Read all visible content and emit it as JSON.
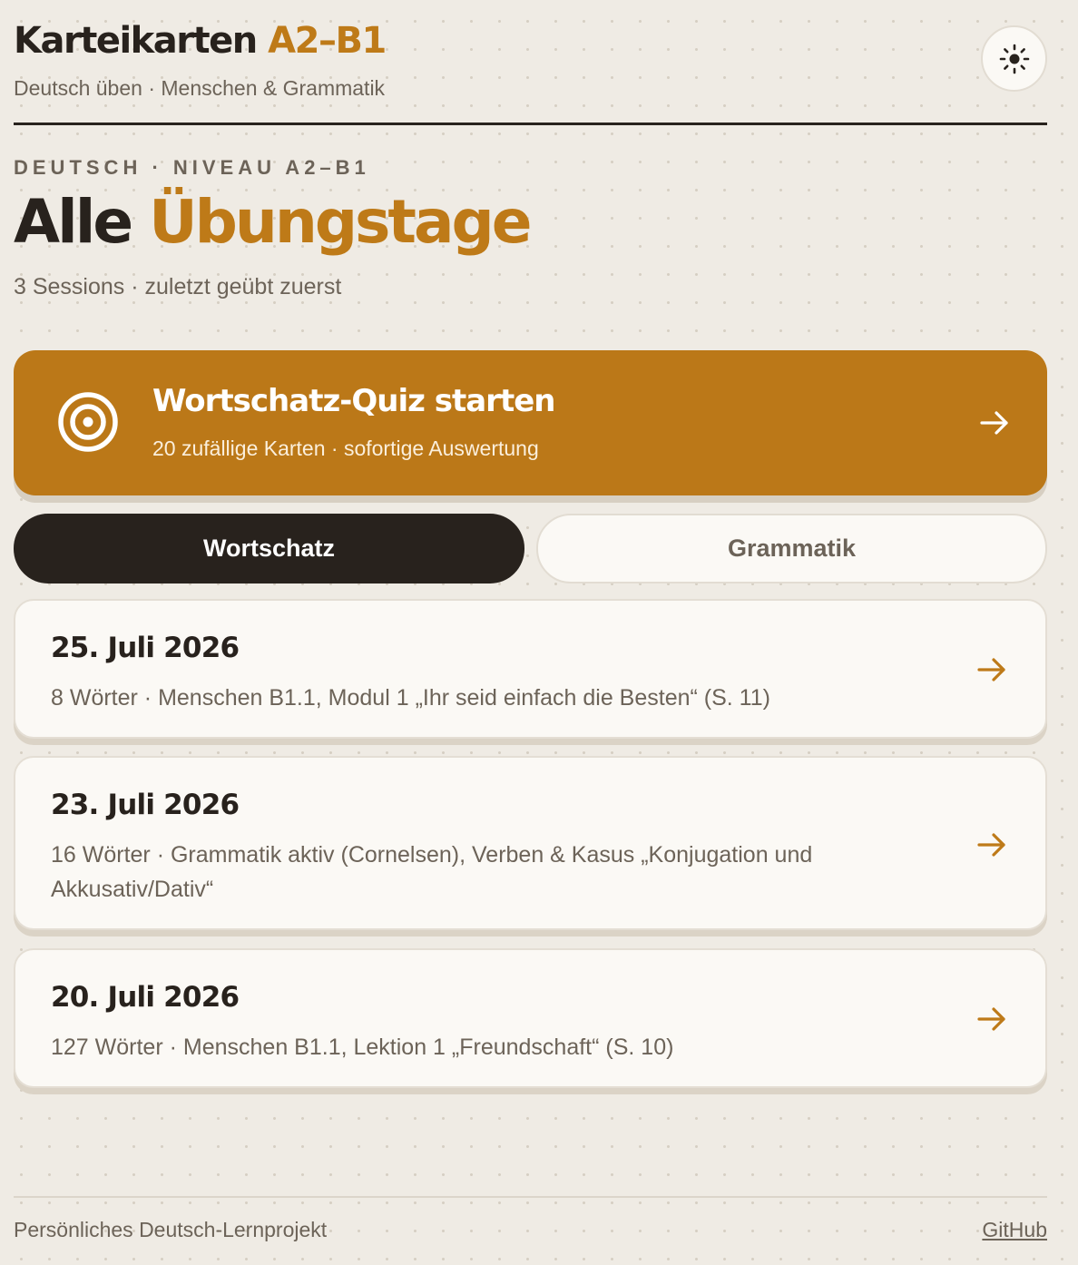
{
  "header": {
    "title": "Karteikarten",
    "title_accent": "A2–B1",
    "subtitle": "Deutsch üben · Menschen & Grammatik",
    "theme_icon": "sun-icon"
  },
  "hero": {
    "eyebrow": "DEUTSCH · NIVEAU A2–B1",
    "title": "Alle",
    "title_accent": "Übungstage",
    "meta": "3 Sessions · zuletzt geübt zuerst"
  },
  "quiz": {
    "icon": "target-icon",
    "title": "Wortschatz-Quiz starten",
    "subtitle": "20 zufällige Karten · sofortige Auswertung",
    "arrow_icon": "arrow-right-icon"
  },
  "tabs": [
    {
      "label": "Wortschatz",
      "active": true
    },
    {
      "label": "Grammatik",
      "active": false
    }
  ],
  "sessions": [
    {
      "date": "25. Juli 2026",
      "description": "8 Wörter · Menschen B1.1, Modul 1 „Ihr seid einfach die Besten“ (S. 11)"
    },
    {
      "date": "23. Juli 2026",
      "description": "16 Wörter · Grammatik aktiv (Cornelsen), Verben & Kasus „Konjugation und Akkusativ/Dativ“"
    },
    {
      "date": "20. Juli 2026",
      "description": "127 Wörter · Menschen B1.1, Lektion 1 „Freundschaft“ (S. 10)"
    }
  ],
  "footer": {
    "text": "Persönliches Deutsch-Lernprojekt",
    "link": "GitHub"
  },
  "colors": {
    "background": "#efebe4",
    "accent": "#be7a18",
    "ink": "#28221d",
    "muted": "#6c6358",
    "card": "#fbf9f5"
  }
}
